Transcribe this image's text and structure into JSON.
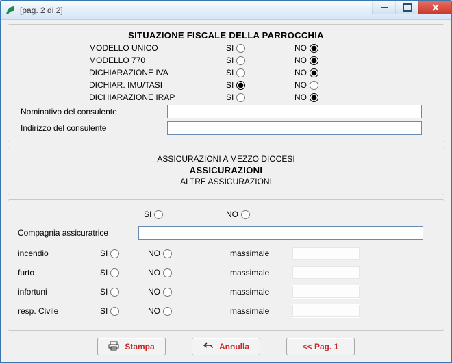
{
  "window": {
    "title": "[pag. 2 di 2]"
  },
  "si_label": "SI",
  "no_label": "NO",
  "fiscal": {
    "heading": "SITUAZIONE FISCALE DELLA PARROCCHIA",
    "rows": [
      {
        "label": "MODELLO UNICO",
        "value": "NO"
      },
      {
        "label": "MODELLO 770",
        "value": "NO"
      },
      {
        "label": "DICHIARAZIONE IVA",
        "value": "NO"
      },
      {
        "label": "DICHIAR. IMU/TASI",
        "value": "SI"
      },
      {
        "label": "DICHIARAZIONE IRAP",
        "value": "NO"
      }
    ],
    "cons_name_label": "Nominativo del consulente",
    "cons_name_value": "",
    "cons_addr_label": "Indirizzo del consulente",
    "cons_addr_value": ""
  },
  "mid": {
    "line1": "ASSICURAZIONI A MEZZO DIOCESI",
    "line2": "ASSICURAZIONI",
    "line3": "ALTRE ASSICURAZIONI"
  },
  "insur": {
    "top_value": null,
    "company_label": "Compagnia assicuratrice",
    "company_value": "",
    "mass_label": "massimale",
    "coverages": [
      {
        "label": "incendio",
        "value": null,
        "mass": ""
      },
      {
        "label": "furto",
        "value": null,
        "mass": ""
      },
      {
        "label": "infortuni",
        "value": null,
        "mass": ""
      },
      {
        "label": "resp. Civile",
        "value": null,
        "mass": ""
      }
    ]
  },
  "buttons": {
    "print": "Stampa",
    "cancel": "Annulla",
    "prev": "<< Pag. 1"
  }
}
